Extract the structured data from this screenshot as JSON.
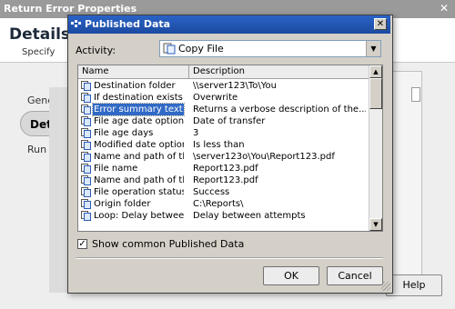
{
  "background_dialog": {
    "title": "Return Error Properties",
    "heading": "Details I",
    "subheading": "Specify",
    "nav_general": "Gene",
    "nav_details": "Deta",
    "nav_run": "Run E",
    "close_glyph": "✕",
    "help_label": "Help"
  },
  "modal": {
    "title": "Published Data",
    "close_glyph": "✕",
    "activity_label": "Activity:",
    "activity_value": "Copy File",
    "activity_arrow": "▼",
    "columns": [
      "Name",
      "Description"
    ],
    "rows": [
      {
        "name": "Destination folder",
        "desc": "\\\\server123\\To\\You",
        "selected": false
      },
      {
        "name": "If destination exists",
        "desc": "Overwrite",
        "selected": false
      },
      {
        "name": "Error summary text",
        "desc": "Returns a verbose description of the...",
        "selected": true
      },
      {
        "name": "File age date option",
        "desc": "Date of transfer",
        "selected": false
      },
      {
        "name": "File age days",
        "desc": "3",
        "selected": false
      },
      {
        "name": "Modified date option",
        "desc": "Is less than",
        "selected": false
      },
      {
        "name": "Name and path of the d...",
        "desc": "\\server123o\\You\\Report123.pdf",
        "selected": false
      },
      {
        "name": "File name",
        "desc": "Report123.pdf",
        "selected": false
      },
      {
        "name": "Name and path of the fi...",
        "desc": "Report123.pdf",
        "selected": false
      },
      {
        "name": "File operation status",
        "desc": "Success",
        "selected": false
      },
      {
        "name": "Origin folder",
        "desc": "C:\\Reports\\",
        "selected": false
      },
      {
        "name": "Loop: Delay between a...",
        "desc": "Delay between attempts",
        "selected": false
      }
    ],
    "show_common_checked": true,
    "check_glyph": "✓",
    "show_common_label": "Show common Published Data",
    "ok_label": "OK",
    "cancel_label": "Cancel",
    "scroll_up_glyph": "▲",
    "scroll_down_glyph": "▼"
  },
  "colors": {
    "selection": "#316ac5",
    "titlebar": "#1c4aa0"
  }
}
